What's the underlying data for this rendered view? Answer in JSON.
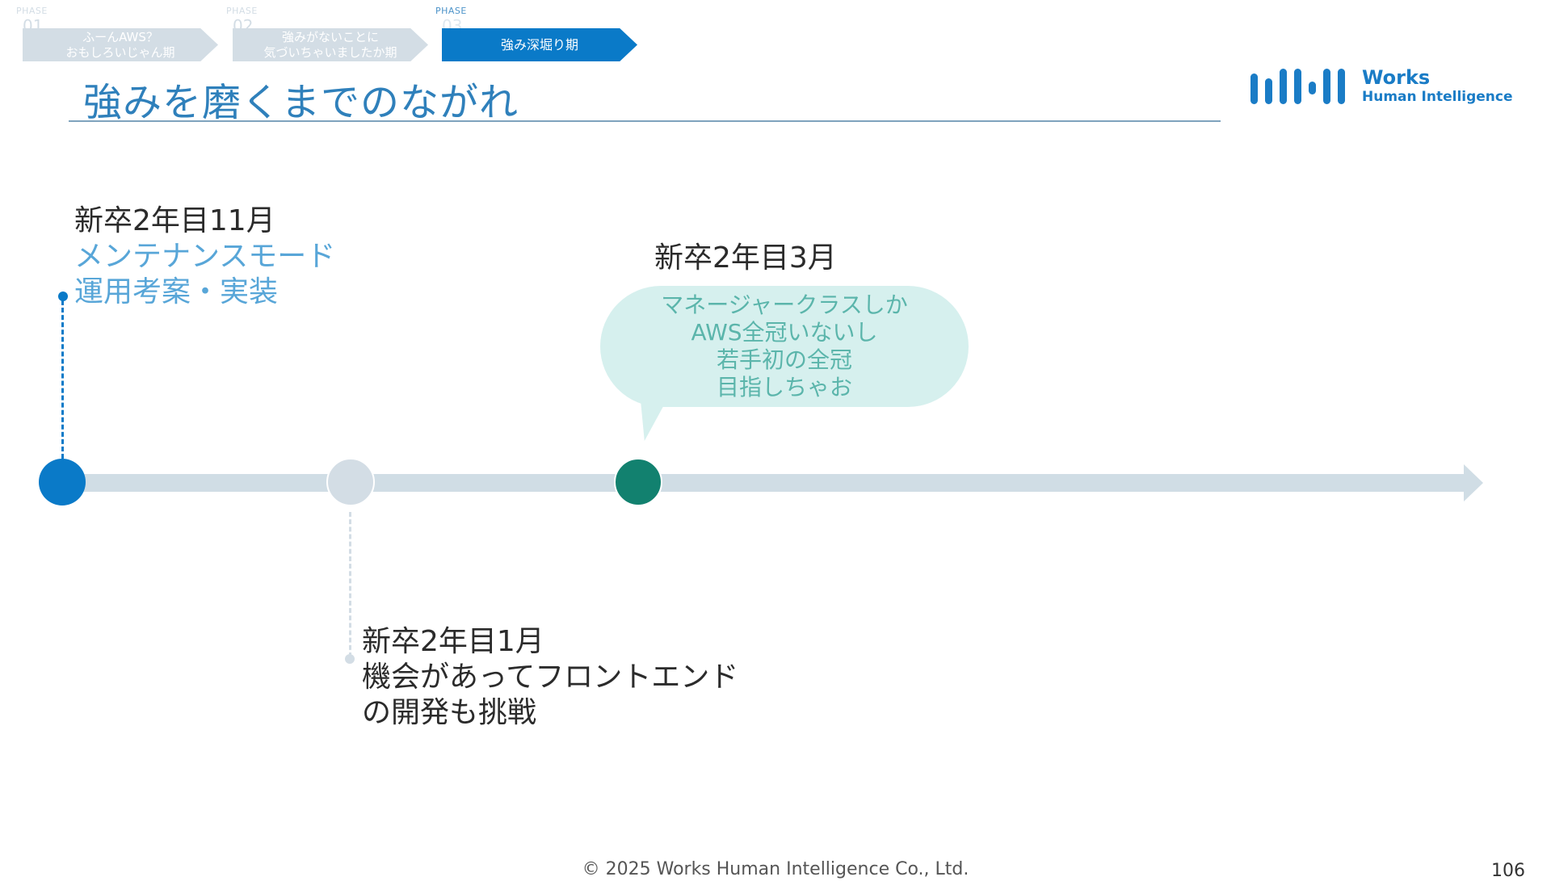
{
  "phases": [
    {
      "label": "PHASE",
      "num": "01",
      "line1": "ふーんAWS？",
      "line2": "おもしろいじゃん期",
      "state": "inactive"
    },
    {
      "label": "PHASE",
      "num": "02",
      "line1": "強みがないことに",
      "line2": "気づいちゃいましたか期",
      "state": "inactive"
    },
    {
      "label": "PHASE",
      "num": "03",
      "line1": "強み深堀り期",
      "line2": "",
      "state": "active"
    }
  ],
  "title": "強みを磨くまでのながれ",
  "logo": {
    "name1": "Works",
    "name2": "Human Intelligence"
  },
  "events": {
    "ev1": {
      "date": "新卒2年目11月",
      "line1": "メンテナンスモード",
      "line2": "運用考案・実装"
    },
    "ev2": {
      "date": "新卒2年目1月",
      "line1": "機会があってフロントエンド",
      "line2": "の開発も挑戦"
    },
    "ev3": {
      "date": "新卒2年目3月"
    }
  },
  "bubble": {
    "lines": [
      "マネージャークラスしか",
      "AWS全冠いないし",
      "若手初の全冠",
      "目指しちゃお"
    ]
  },
  "footer": {
    "copyright": "© 2025 Works Human Intelligence Co., Ltd.",
    "page": "106"
  },
  "colors": {
    "accent": "#0a7ac8",
    "inactive": "#d3dde5",
    "teal": "#12816f",
    "bubble": "#d6f0ee"
  }
}
